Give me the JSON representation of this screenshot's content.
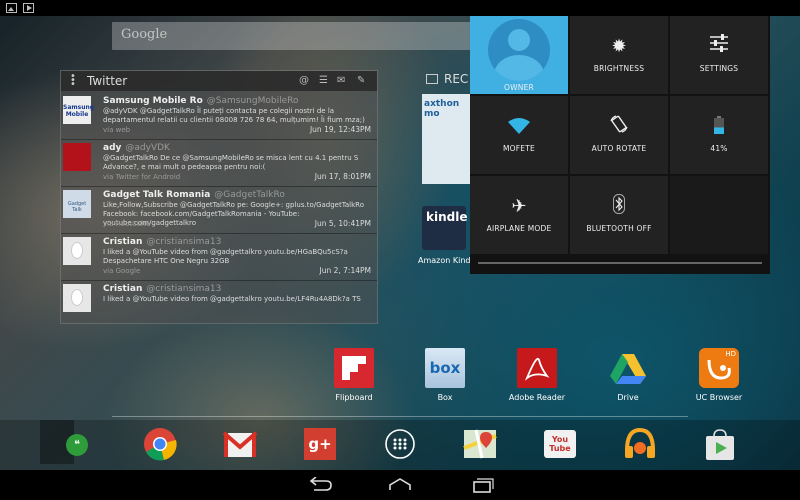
{
  "colors": {
    "owner_tile": "#40b0e2",
    "wifi_active": "#33b5e5",
    "panel_bg": "#121212",
    "tile_bg": "#222222"
  },
  "search": {
    "placeholder": "Google"
  },
  "twitter": {
    "title": "Twitter",
    "tweets": [
      {
        "name": "Samsung Mobile Ro",
        "handle": "@SamsungMobileRo",
        "text": "@adyVDK @GadgetTalkRo Îl puteți contacta pe colegii nostri de la departamentul relatii cu clientii 08008 726 78 64, mulțumim! Îi fium mza;)",
        "via": "via web",
        "date": "Jun 19, 12:43PM",
        "avatar_text": "Samsung Mobile"
      },
      {
        "name": "ady",
        "handle": "@adyVDK",
        "text": "@GadgetTalkRo De ce @SamsungMobileRo se misca lent cu 4.1 pentru S Advance?, e mai mult o pedeapsa pentru noi:(",
        "via": "via Twitter for Android",
        "date": "Jun 17, 8:01PM",
        "avatar_text": ""
      },
      {
        "name": "Gadget Talk Romania",
        "handle": "@GadgetTalkRo",
        "text": "Like,Follow,Subscribe @GadgetTalkRo pe: Google+: gplus.to/GadgetTalkRo Facebook: facebook.com/GadgetTalkRomania - YouTube: youtube.com/gadgettalkro",
        "via": "via HootSuite",
        "date": "Jun 5, 10:41PM",
        "avatar_text": "Gadget Talk"
      },
      {
        "name": "Cristian",
        "handle": "@cristiansima13",
        "text": "I liked a @YouTube video from @gadgettalkro youtu.be/HGaBQu5cS?a Despachetare HTC One Negru 32GB",
        "via": "via Google",
        "date": "Jun 2, 7:14PM",
        "avatar_text": ""
      },
      {
        "name": "Cristian",
        "handle": "@cristiansima13",
        "text": "I liked a @YouTube video from @gadgettalkro youtu.be/LF4Ru4A8Dk?a TS",
        "via": "",
        "date": "",
        "avatar_text": ""
      }
    ]
  },
  "recent_widget": {
    "label": "REC",
    "thumb_text": "axthon mo"
  },
  "kindle": {
    "icon_text": "kindle",
    "label": "Amazon Kindle"
  },
  "quick_settings": {
    "owner": "OWNER",
    "brightness": "BRIGHTNESS",
    "settings": "SETTINGS",
    "wifi": "MOFETE",
    "auto_rotate": "AUTO ROTATE",
    "battery": "41%",
    "battery_level": 0.41,
    "airplane": "AIRPLANE MODE",
    "bluetooth": "BLUETOOTH OFF"
  },
  "apps": {
    "flipboard": "Flipboard",
    "box": "Box",
    "box_icon_text": "box",
    "adobe": "Adobe Reader",
    "drive": "Drive",
    "ucbrowser": "UC Browser",
    "ucbrowser_badge": "HD"
  },
  "dock": {
    "gplus_text": "g+",
    "youtube_text": "You Tube"
  }
}
